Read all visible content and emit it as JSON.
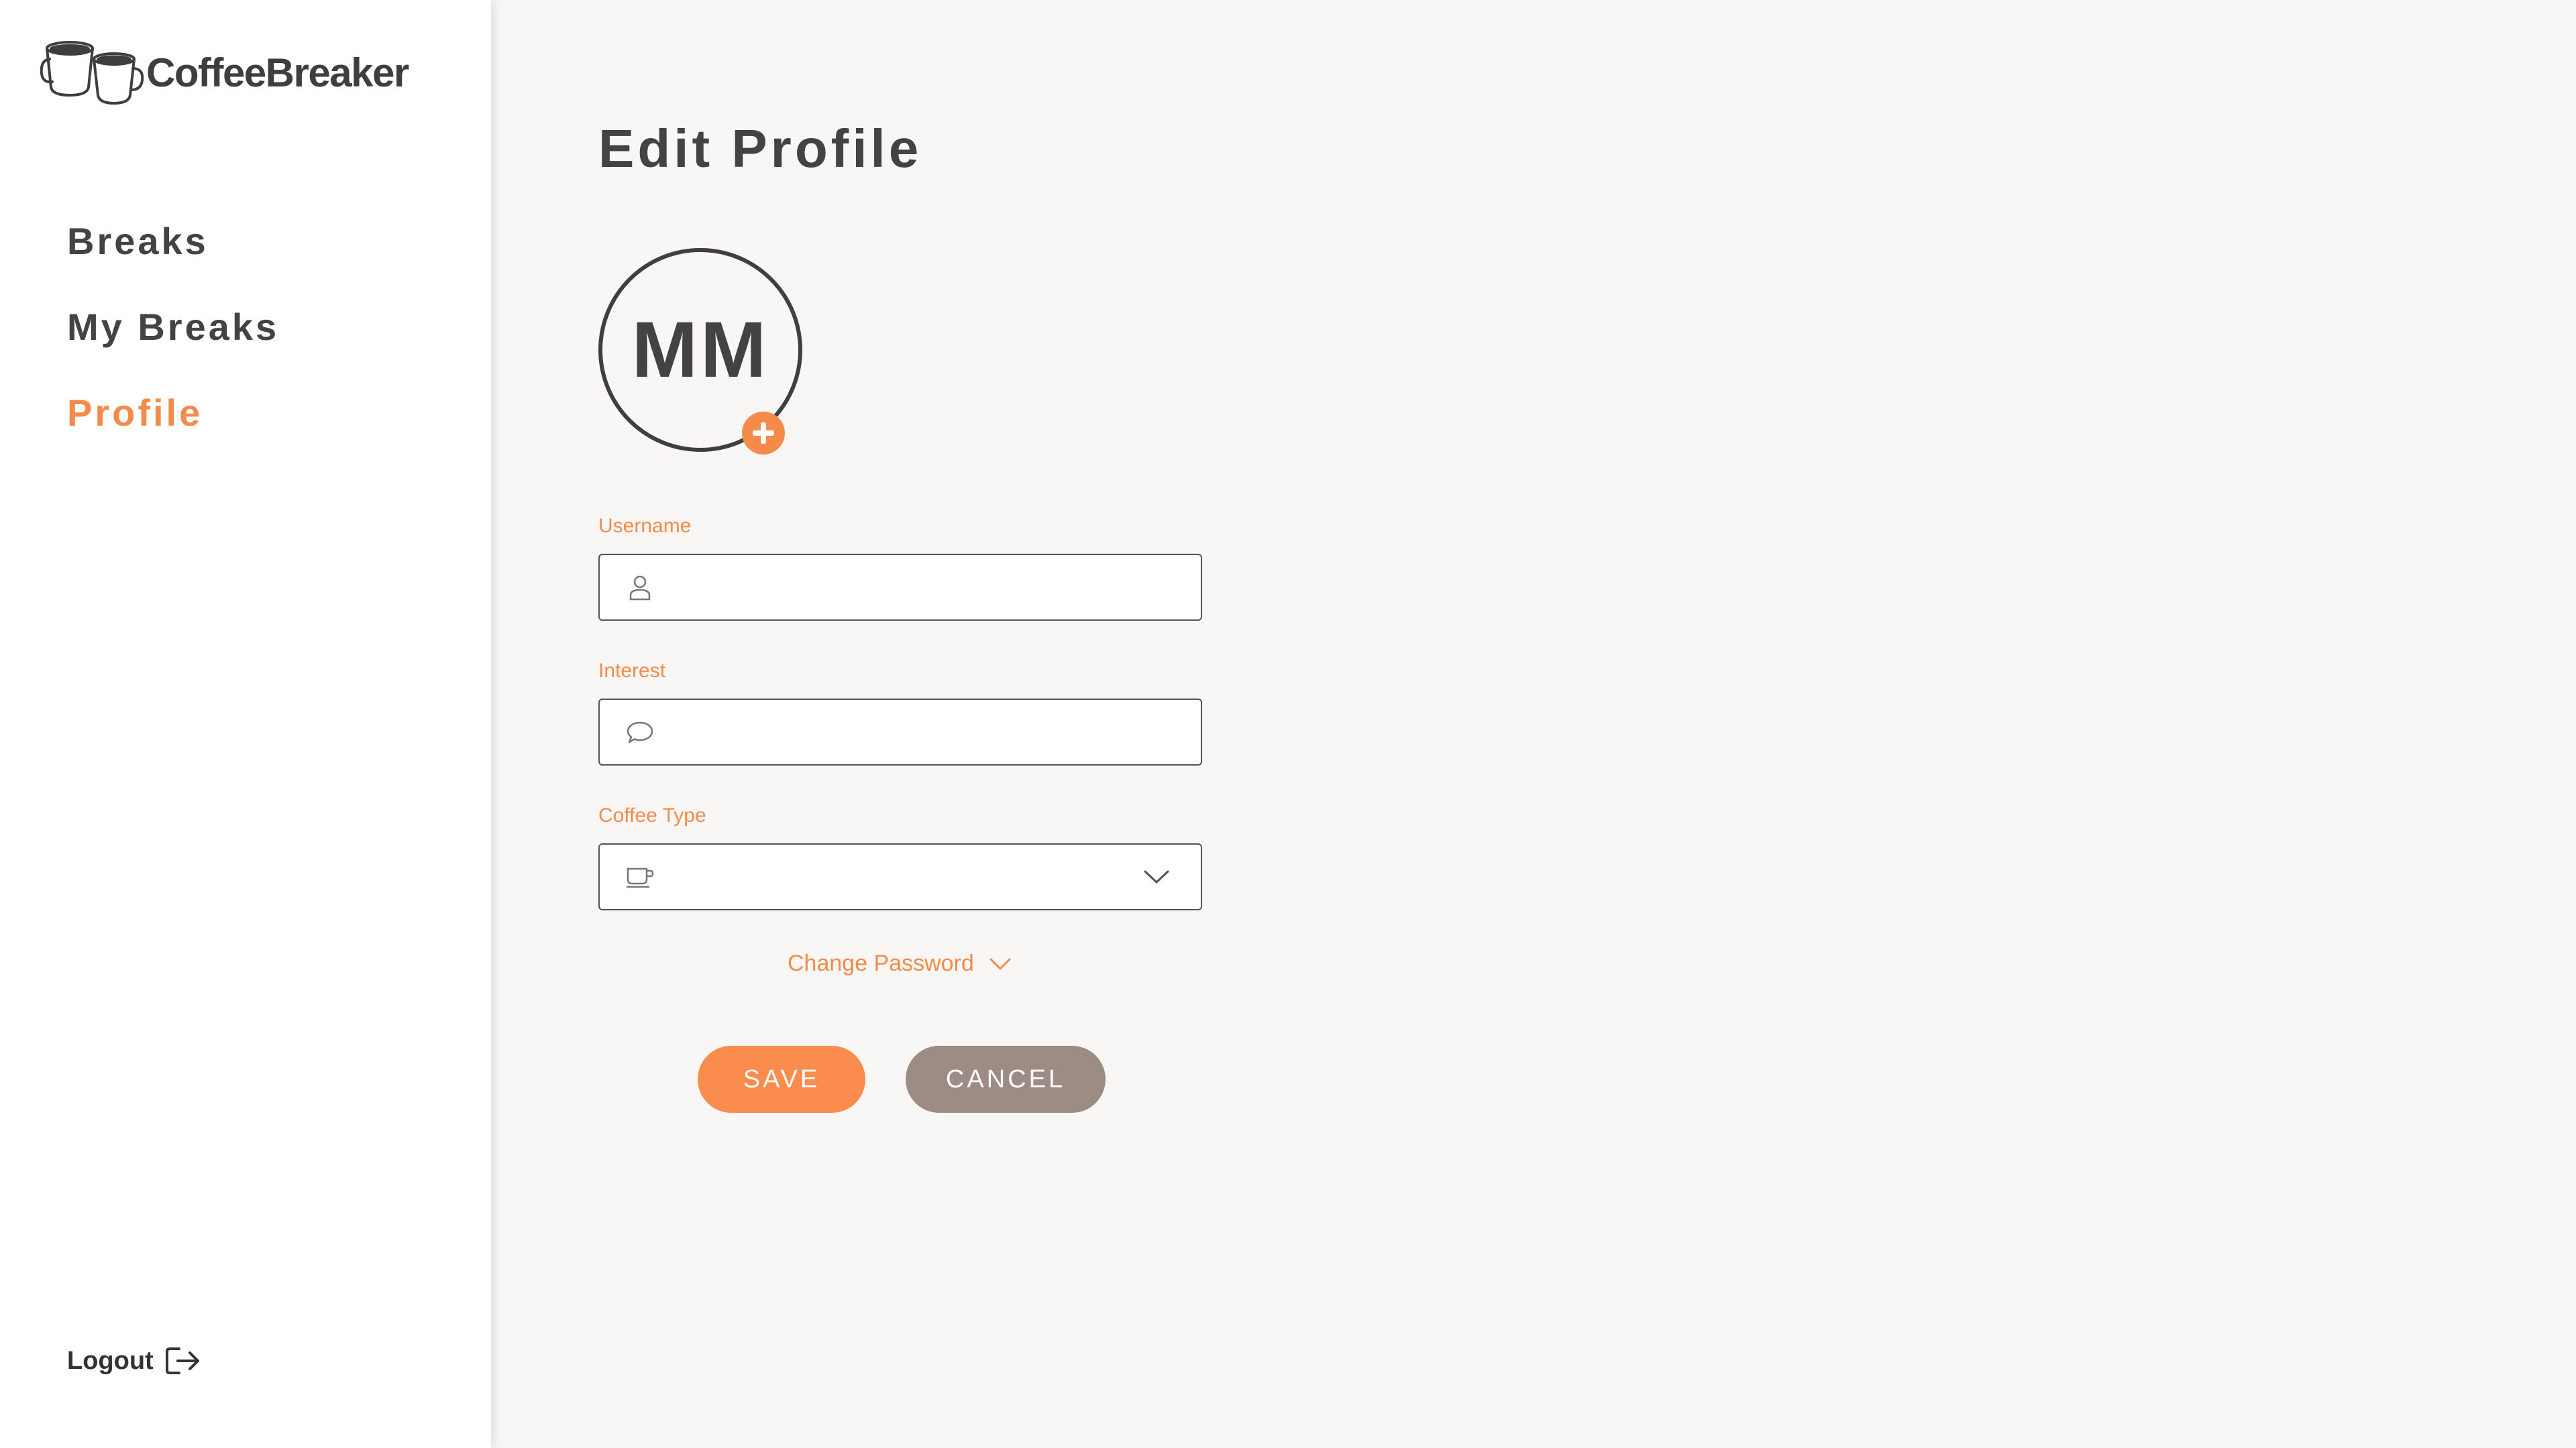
{
  "app": {
    "name": "CoffeeBreaker",
    "accent_color": "#f58b4a",
    "logo_icon": "coffee-cups-icon"
  },
  "nav": {
    "items": [
      {
        "label": "Breaks",
        "active": false
      },
      {
        "label": "My Breaks",
        "active": false
      },
      {
        "label": "Profile",
        "active": true
      }
    ],
    "logout_label": "Logout",
    "logout_icon": "logout-icon"
  },
  "page": {
    "title": "Edit Profile"
  },
  "avatar": {
    "initials": "MM",
    "add_icon": "plus-icon"
  },
  "form": {
    "username": {
      "label": "Username",
      "value": "",
      "icon": "user-icon"
    },
    "interest": {
      "label": "Interest",
      "value": "",
      "icon": "chat-bubble-icon"
    },
    "coffee_type": {
      "label": "Coffee Type",
      "value": "",
      "icon": "coffee-cup-icon"
    },
    "change_password_label": "Change Password",
    "save_label": "SAVE",
    "cancel_label": "CANCEL",
    "save_color": "#fa8d4d",
    "cancel_color": "#9c8c84"
  }
}
